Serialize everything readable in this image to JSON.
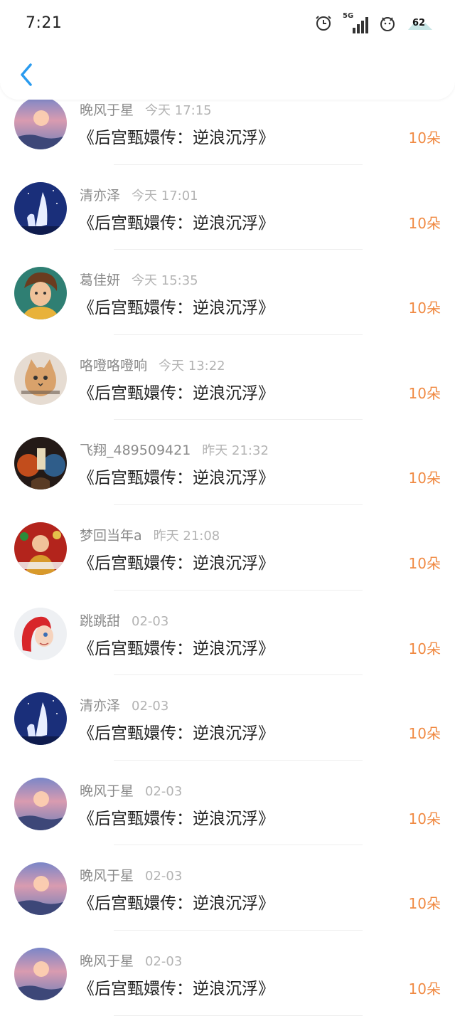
{
  "status": {
    "time": "7:21",
    "network": "5G",
    "battery": "62"
  },
  "records": [
    {
      "user": "晚风于星",
      "time": "今天 17:15",
      "title": "《后宫甄嬛传：逆浪沉浮》",
      "amount": "10朵",
      "avatar": "sunset-sky-avatar"
    },
    {
      "user": "清亦泽",
      "time": "今天 17:01",
      "title": "《后宫甄嬛传：逆浪沉浮》",
      "amount": "10朵",
      "avatar": "white-deer-night-avatar"
    },
    {
      "user": "葛佳妍",
      "time": "今天 15:35",
      "title": "《后宫甄嬛传：逆浪沉浮》",
      "amount": "10朵",
      "avatar": "anime-boy-avatar"
    },
    {
      "user": "咯噔咯噔响",
      "time": "今天 13:22",
      "title": "《后宫甄嬛传：逆浪沉浮》",
      "amount": "10朵",
      "avatar": "cat-meme-avatar"
    },
    {
      "user": "飞翔_489509421",
      "time": "昨天 21:32",
      "title": "《后宫甄嬛传：逆浪沉浮》",
      "amount": "10朵",
      "avatar": "movie-poster-avatar"
    },
    {
      "user": "梦回当年a",
      "time": "昨天 21:08",
      "title": "《后宫甄嬛传：逆浪沉浮》",
      "amount": "10朵",
      "avatar": "red-poster-avatar"
    },
    {
      "user": "跳跳甜",
      "time": "02-03",
      "title": "《后宫甄嬛传：逆浪沉浮》",
      "amount": "10朵",
      "avatar": "mermaid-avatar"
    },
    {
      "user": "清亦泽",
      "time": "02-03",
      "title": "《后宫甄嬛传：逆浪沉浮》",
      "amount": "10朵",
      "avatar": "white-deer-night-avatar"
    },
    {
      "user": "晚风于星",
      "time": "02-03",
      "title": "《后宫甄嬛传：逆浪沉浮》",
      "amount": "10朵",
      "avatar": "sunset-sky-avatar"
    },
    {
      "user": "晚风于星",
      "time": "02-03",
      "title": "《后宫甄嬛传：逆浪沉浮》",
      "amount": "10朵",
      "avatar": "sunset-sky-avatar"
    },
    {
      "user": "晚风于星",
      "time": "02-03",
      "title": "《后宫甄嬛传：逆浪沉浮》",
      "amount": "10朵",
      "avatar": "sunset-sky-avatar"
    }
  ],
  "colors": {
    "accent": "#f08a43",
    "back": "#2a9bef"
  }
}
